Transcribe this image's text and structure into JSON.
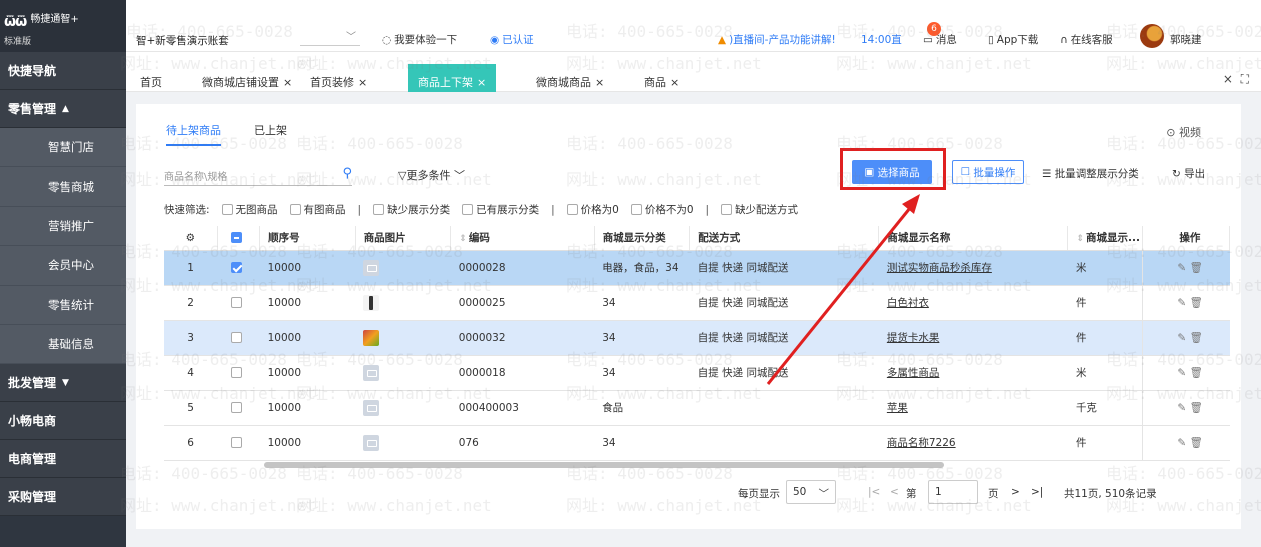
{
  "sidebar": {
    "logo_mark": "ѿѿ",
    "logo_name": "畅捷通智+",
    "logo_sub": "标准版",
    "items": [
      {
        "label": "快捷导航",
        "type": "group",
        "caret": ""
      },
      {
        "label": "零售管理",
        "type": "group",
        "caret": "▲"
      },
      {
        "label": "智慧门店",
        "type": "sub"
      },
      {
        "label": "零售商城",
        "type": "sub"
      },
      {
        "label": "营销推广",
        "type": "sub"
      },
      {
        "label": "会员中心",
        "type": "sub"
      },
      {
        "label": "零售统计",
        "type": "sub"
      },
      {
        "label": "基础信息",
        "type": "sub"
      },
      {
        "label": "批发管理",
        "type": "group",
        "caret": "▼"
      },
      {
        "label": "小畅电商",
        "type": "group",
        "caret": ""
      },
      {
        "label": "电商管理",
        "type": "group",
        "caret": ""
      },
      {
        "label": "采购管理",
        "type": "group",
        "caret": ""
      }
    ]
  },
  "topbar": {
    "account": "智+新零售演示账套",
    "trial": "我要体验一下",
    "certified": "已认证",
    "live": ")直播间-产品功能讲解!",
    "live_time": "14:00直",
    "message": "消息",
    "message_badge": "6",
    "app": "App下载",
    "service": "在线客服",
    "user": "郭晓建"
  },
  "tabs": {
    "items": [
      {
        "label": "首页",
        "closable": false
      },
      {
        "label": "微商城店铺设置",
        "closable": true
      },
      {
        "label": "首页装修",
        "closable": true
      },
      {
        "label": "商品上下架",
        "closable": true,
        "active": true
      },
      {
        "label": "微商城商品",
        "closable": true
      },
      {
        "label": "商品",
        "closable": true
      }
    ],
    "close_all": "×",
    "fullscreen": "⛶"
  },
  "content": {
    "subtabs": [
      "待上架商品",
      "已上架"
    ],
    "video": "视频",
    "search_placeholder": "商品名称\\规格",
    "more_conditions": "更多条件",
    "select_goods": "选择商品",
    "batch_op": "批量操作",
    "batch_category": "批量调整展示分类",
    "export": "导出",
    "filter_label": "快速筛选:",
    "filters": [
      "无图商品",
      "有图商品",
      "缺少展示分类",
      "已有展示分类",
      "价格为0",
      "价格不为0",
      "缺少配送方式"
    ]
  },
  "table": {
    "columns": [
      "顺序号",
      "商品图片",
      "编码",
      "商城显示分类",
      "配送方式",
      "商城显示名称",
      "商城显示...",
      "操作"
    ],
    "rows": [
      {
        "n": "1",
        "checked": true,
        "seq": "10000",
        "img": "placeholder",
        "code": "0000028",
        "cat": "电器，食品，34",
        "ship": "自提 快递 同城配送",
        "name": "测试实物商品秒杀库存",
        "unit": "米",
        "state": "sel"
      },
      {
        "n": "2",
        "checked": false,
        "seq": "10000",
        "img": "person",
        "code": "0000025",
        "cat": "34",
        "ship": "自提 快递 同城配送",
        "name": "白色衬衣",
        "unit": "件",
        "state": ""
      },
      {
        "n": "3",
        "checked": false,
        "seq": "10000",
        "img": "fruit",
        "code": "0000032",
        "cat": "34",
        "ship": "自提 快递 同城配送",
        "name": "提货卡水果",
        "unit": "件",
        "state": "hl"
      },
      {
        "n": "4",
        "checked": false,
        "seq": "10000",
        "img": "placeholder",
        "code": "0000018",
        "cat": "34",
        "ship": "自提 快递 同城配送",
        "name": "多属性商品",
        "unit": "米",
        "state": ""
      },
      {
        "n": "5",
        "checked": false,
        "seq": "10000",
        "img": "placeholder",
        "code": "000400003",
        "cat": "食品",
        "ship": "",
        "name": "苹果",
        "unit": "千克",
        "state": ""
      },
      {
        "n": "6",
        "checked": false,
        "seq": "10000",
        "img": "placeholder",
        "code": "076",
        "cat": "34",
        "ship": "",
        "name": "商品名称7226",
        "unit": "件",
        "state": ""
      }
    ]
  },
  "pager": {
    "per_page_label": "每页显示",
    "per_page": "50",
    "page_label": "第",
    "page": "1",
    "page_suffix": "页",
    "summary": "共11页, 510条记录"
  },
  "watermark": {
    "phone": "电话: 400-665-0028",
    "site": "网址: www.chanjet.net"
  },
  "colors": {
    "accent": "#2f7cf6",
    "tab_active": "#35c6b8",
    "highlight_box": "#e02020",
    "sidebar": "#2f3640"
  }
}
